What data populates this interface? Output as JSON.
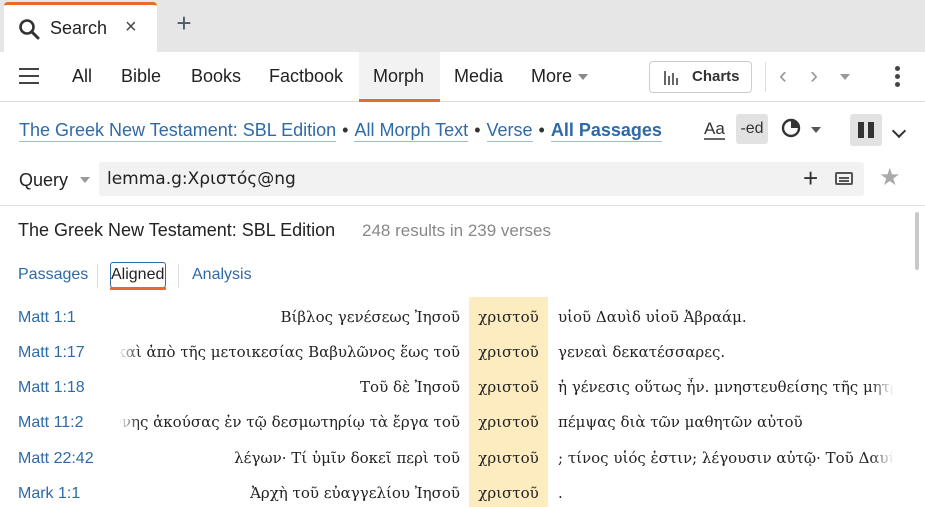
{
  "tab": {
    "label": "Search",
    "close": "×",
    "new_tab": "+"
  },
  "nav": {
    "items": [
      "All",
      "Bible",
      "Books",
      "Factbook",
      "Morph",
      "Media",
      "More"
    ],
    "active": "Morph"
  },
  "toolbar": {
    "charts_label": "Charts",
    "back": "‹",
    "forward": "›"
  },
  "scope": {
    "resource": "The Greek New Testament: SBL Edition",
    "text": "All Morph Text",
    "unit": "Verse",
    "range": "All Passages",
    "font_toggle": "Aa",
    "ed_toggle": "-ed"
  },
  "query": {
    "label": "Query",
    "value": "lemma.g:Χριστός@ng",
    "add": "+"
  },
  "results": {
    "title": "The Greek New Testament: SBL Edition",
    "count": "248 results in 239 verses"
  },
  "views": {
    "passages": "Passages",
    "aligned": "Aligned",
    "analysis": "Analysis"
  },
  "rows": [
    {
      "ref": "Matt 1:1",
      "pre": "Βίβλος γενέσεως Ἰησοῦ",
      "hit": "χριστοῦ",
      "post": "υἱοῦ Δαυὶδ υἱοῦ Ἀβραάμ."
    },
    {
      "ref": "Matt 1:17",
      "pre": "ς καὶ ἀπὸ τῆς μετοικεσίας Βαβυλῶνος ἕως τοῦ",
      "hit": "χριστοῦ",
      "post": "γενεαὶ δεκατέσσαρες."
    },
    {
      "ref": "Matt 1:18",
      "pre": "Τοῦ δὲ Ἰησοῦ",
      "hit": "χριστοῦ",
      "post": "ἡ γένεσις οὕτως ἦν. μνηστευθείσης τῆς μητρὸς"
    },
    {
      "ref": "Matt 11:2",
      "pre": "ἰωάννης ἀκούσας ἐν τῷ δεσμωτηρίῳ τὰ ἔργα τοῦ",
      "hit": "χριστοῦ",
      "post": "πέμψας διὰ τῶν μαθητῶν αὐτοῦ"
    },
    {
      "ref": "Matt 22:42",
      "pre": "λέγων· Τί ὑμῖν δοκεῖ περὶ τοῦ",
      "hit": "χριστοῦ",
      "post": "; τίνος υἱός ἐστιν; λέγουσιν αὐτῷ· Τοῦ Δαυίδ."
    },
    {
      "ref": "Mark 1:1",
      "pre": "Ἀρχὴ τοῦ εὐαγγελίου Ἰησοῦ",
      "hit": "χριστοῦ",
      "post": "."
    }
  ],
  "colors": {
    "accent": "#e66a2c",
    "link": "#2e6aa8",
    "hit_highlight": "#fdecbf"
  }
}
